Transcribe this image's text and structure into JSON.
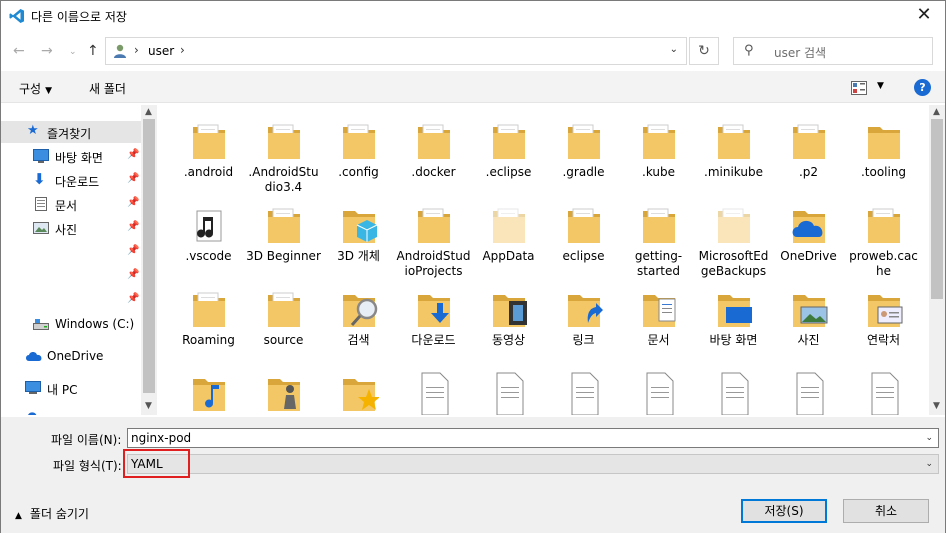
{
  "window": {
    "title": "다른 이름으로 저장"
  },
  "address": {
    "crumb": "user",
    "search_placeholder": "user 검색"
  },
  "toolbar": {
    "organize": "구성",
    "new_folder": "새 폴더"
  },
  "nav": [
    {
      "label": "즐겨찾기",
      "icon": "star-icon"
    },
    {
      "label": "바탕 화면",
      "icon": "desktop-icon"
    },
    {
      "label": "다운로드",
      "icon": "download-icon"
    },
    {
      "label": "문서",
      "icon": "document-icon"
    },
    {
      "label": "사진",
      "icon": "pictures-icon"
    },
    {
      "label": "Windows (C:)",
      "icon": "drive-icon"
    },
    {
      "label": "OneDrive",
      "icon": "cloud-icon"
    },
    {
      "label": "내 PC",
      "icon": "pc-icon"
    }
  ],
  "items": [
    {
      "name": ".android"
    },
    {
      "name": ".AndroidStudio3.4"
    },
    {
      "name": ".config"
    },
    {
      "name": ".docker"
    },
    {
      "name": ".eclipse"
    },
    {
      "name": ".gradle"
    },
    {
      "name": ".kube"
    },
    {
      "name": ".minikube"
    },
    {
      "name": ".p2"
    },
    {
      "name": ".tooling"
    },
    {
      "name": ".vscode"
    },
    {
      "name": "3D Beginner"
    },
    {
      "name": "3D 개체"
    },
    {
      "name": "AndroidStudioProjects"
    },
    {
      "name": "AppData"
    },
    {
      "name": "eclipse"
    },
    {
      "name": "getting-started"
    },
    {
      "name": "MicrosoftEdgeBackups"
    },
    {
      "name": "OneDrive"
    },
    {
      "name": "proweb.cache"
    },
    {
      "name": "Roaming"
    },
    {
      "name": "source"
    },
    {
      "name": "검색"
    },
    {
      "name": "다운로드"
    },
    {
      "name": "동영상"
    },
    {
      "name": "링크"
    },
    {
      "name": "문서"
    },
    {
      "name": "바탕 화면"
    },
    {
      "name": "사진"
    },
    {
      "name": "연락처"
    }
  ],
  "fields": {
    "filename_label": "파일 이름(N):",
    "filename_value": "nginx-pod",
    "filetype_label": "파일 형식(T):",
    "filetype_value": "YAML"
  },
  "footer": {
    "hide_folders": "폴더 숨기기",
    "save": "저장(S)",
    "cancel": "취소"
  },
  "colors": {
    "folder": "#f3c766",
    "highlight": "#e02020",
    "accent": "#0078d7"
  }
}
